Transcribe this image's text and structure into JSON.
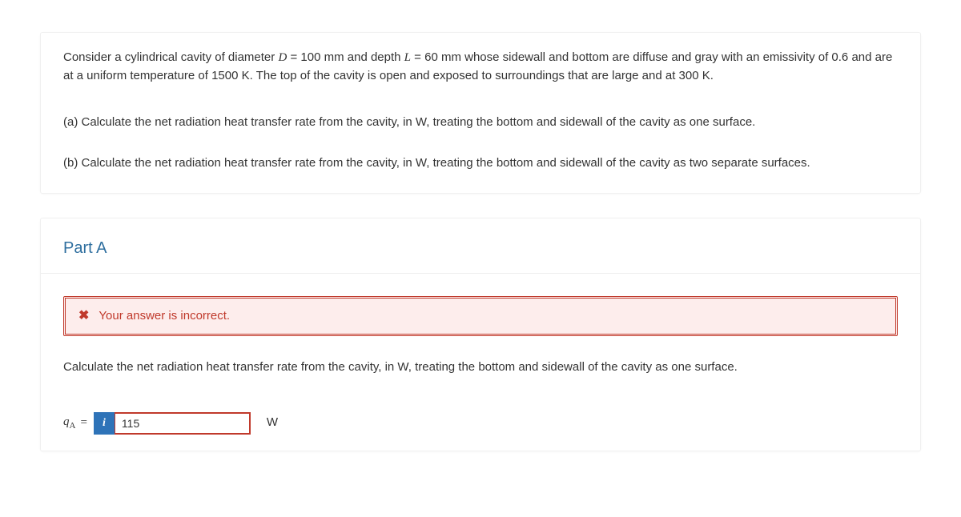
{
  "problem": {
    "intro_prefix": "Consider a cylindrical cavity of diameter ",
    "D_var": "D",
    "eq_sign1": " = ",
    "D_val": "100 mm and depth ",
    "L_var": "L",
    "eq_sign2": " = ",
    "L_val": " 60 mm whose sidewall and bottom are diffuse and gray with an emissivity of 0.6 and are at a uniform temperature of 1500 K. The top of the cavity is open and exposed to surroundings that are large and at 300 K.",
    "part_a": "(a) Calculate the net radiation heat transfer rate from the cavity, in W, treating the bottom and sidewall of the cavity as one surface.",
    "part_b": "(b) Calculate the net radiation heat transfer rate from the cavity, in W, treating the bottom and sidewall of the cavity as two separate surfaces."
  },
  "partA": {
    "title": "Part A",
    "feedback": "Your answer is incorrect.",
    "instruction": "Calculate the net radiation heat transfer rate from the cavity, in W, treating the bottom and sidewall of the cavity as one surface.",
    "var_label": "q",
    "var_sub": "A",
    "eq": "=",
    "info_icon": "i",
    "value": "115",
    "unit": "W"
  }
}
